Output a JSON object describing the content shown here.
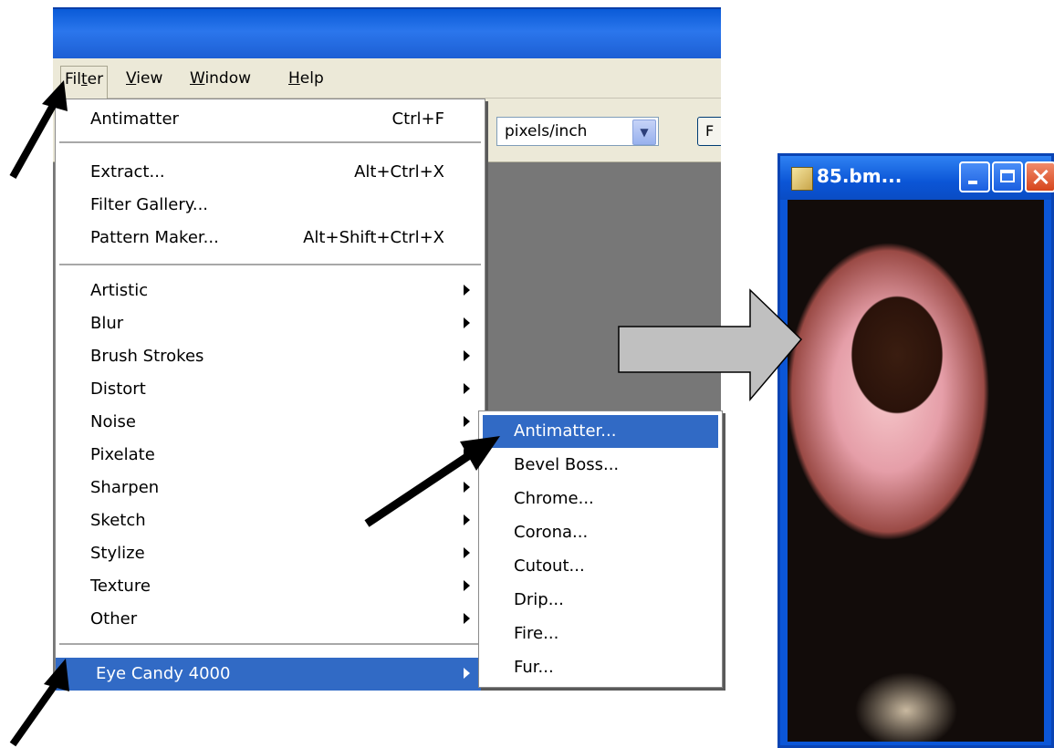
{
  "menubar": {
    "items": [
      "Filter",
      "View",
      "Window",
      "Help"
    ]
  },
  "options": {
    "units": "pixels/inch",
    "extra_button": "F"
  },
  "filter_menu": {
    "top_items": [
      {
        "label": "Antimatter",
        "shortcut": "Ctrl+F"
      }
    ],
    "group2": [
      {
        "label": "Extract...",
        "shortcut": "Alt+Ctrl+X"
      },
      {
        "label": "Filter Gallery...",
        "shortcut": ""
      },
      {
        "label": "Pattern Maker...",
        "shortcut": "Alt+Shift+Ctrl+X"
      }
    ],
    "submenus": [
      "Artistic",
      "Blur",
      "Brush Strokes",
      "Distort",
      "Noise",
      "Pixelate",
      "Sharpen",
      "Sketch",
      "Stylize",
      "Texture",
      "Other"
    ],
    "plugin": "Eye Candy 4000"
  },
  "eye_candy_menu": [
    "Antimatter...",
    "Bevel Boss...",
    "Chrome...",
    "Corona...",
    "Cutout...",
    "Drip...",
    "Fire...",
    "Fur..."
  ],
  "image_window": {
    "title": "85.bm..."
  }
}
